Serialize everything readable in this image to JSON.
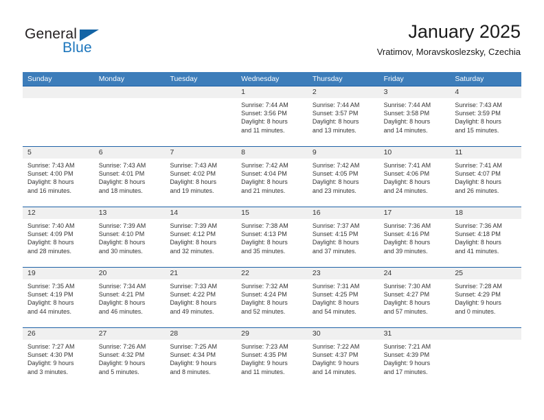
{
  "brand": {
    "word_one": "General",
    "word_two": "Blue",
    "accent_dark": "#1464a5",
    "accent_light": "#1b75bc"
  },
  "header": {
    "title": "January 2025",
    "subtitle": "Vratimov, Moravskoslezsky, Czechia"
  },
  "theme": {
    "header_bar": "#3d7dba",
    "row_separator": "#1b5fa5",
    "day_number_band": "#f0f0f0",
    "text": "#333333"
  },
  "weekdays": [
    "Sunday",
    "Monday",
    "Tuesday",
    "Wednesday",
    "Thursday",
    "Friday",
    "Saturday"
  ],
  "weeks": [
    [
      {
        "day": "",
        "lines": []
      },
      {
        "day": "",
        "lines": []
      },
      {
        "day": "",
        "lines": []
      },
      {
        "day": "1",
        "lines": [
          "Sunrise: 7:44 AM",
          "Sunset: 3:56 PM",
          "Daylight: 8 hours",
          "and 11 minutes."
        ]
      },
      {
        "day": "2",
        "lines": [
          "Sunrise: 7:44 AM",
          "Sunset: 3:57 PM",
          "Daylight: 8 hours",
          "and 13 minutes."
        ]
      },
      {
        "day": "3",
        "lines": [
          "Sunrise: 7:44 AM",
          "Sunset: 3:58 PM",
          "Daylight: 8 hours",
          "and 14 minutes."
        ]
      },
      {
        "day": "4",
        "lines": [
          "Sunrise: 7:43 AM",
          "Sunset: 3:59 PM",
          "Daylight: 8 hours",
          "and 15 minutes."
        ]
      }
    ],
    [
      {
        "day": "5",
        "lines": [
          "Sunrise: 7:43 AM",
          "Sunset: 4:00 PM",
          "Daylight: 8 hours",
          "and 16 minutes."
        ]
      },
      {
        "day": "6",
        "lines": [
          "Sunrise: 7:43 AM",
          "Sunset: 4:01 PM",
          "Daylight: 8 hours",
          "and 18 minutes."
        ]
      },
      {
        "day": "7",
        "lines": [
          "Sunrise: 7:43 AM",
          "Sunset: 4:02 PM",
          "Daylight: 8 hours",
          "and 19 minutes."
        ]
      },
      {
        "day": "8",
        "lines": [
          "Sunrise: 7:42 AM",
          "Sunset: 4:04 PM",
          "Daylight: 8 hours",
          "and 21 minutes."
        ]
      },
      {
        "day": "9",
        "lines": [
          "Sunrise: 7:42 AM",
          "Sunset: 4:05 PM",
          "Daylight: 8 hours",
          "and 23 minutes."
        ]
      },
      {
        "day": "10",
        "lines": [
          "Sunrise: 7:41 AM",
          "Sunset: 4:06 PM",
          "Daylight: 8 hours",
          "and 24 minutes."
        ]
      },
      {
        "day": "11",
        "lines": [
          "Sunrise: 7:41 AM",
          "Sunset: 4:07 PM",
          "Daylight: 8 hours",
          "and 26 minutes."
        ]
      }
    ],
    [
      {
        "day": "12",
        "lines": [
          "Sunrise: 7:40 AM",
          "Sunset: 4:09 PM",
          "Daylight: 8 hours",
          "and 28 minutes."
        ]
      },
      {
        "day": "13",
        "lines": [
          "Sunrise: 7:39 AM",
          "Sunset: 4:10 PM",
          "Daylight: 8 hours",
          "and 30 minutes."
        ]
      },
      {
        "day": "14",
        "lines": [
          "Sunrise: 7:39 AM",
          "Sunset: 4:12 PM",
          "Daylight: 8 hours",
          "and 32 minutes."
        ]
      },
      {
        "day": "15",
        "lines": [
          "Sunrise: 7:38 AM",
          "Sunset: 4:13 PM",
          "Daylight: 8 hours",
          "and 35 minutes."
        ]
      },
      {
        "day": "16",
        "lines": [
          "Sunrise: 7:37 AM",
          "Sunset: 4:15 PM",
          "Daylight: 8 hours",
          "and 37 minutes."
        ]
      },
      {
        "day": "17",
        "lines": [
          "Sunrise: 7:36 AM",
          "Sunset: 4:16 PM",
          "Daylight: 8 hours",
          "and 39 minutes."
        ]
      },
      {
        "day": "18",
        "lines": [
          "Sunrise: 7:36 AM",
          "Sunset: 4:18 PM",
          "Daylight: 8 hours",
          "and 41 minutes."
        ]
      }
    ],
    [
      {
        "day": "19",
        "lines": [
          "Sunrise: 7:35 AM",
          "Sunset: 4:19 PM",
          "Daylight: 8 hours",
          "and 44 minutes."
        ]
      },
      {
        "day": "20",
        "lines": [
          "Sunrise: 7:34 AM",
          "Sunset: 4:21 PM",
          "Daylight: 8 hours",
          "and 46 minutes."
        ]
      },
      {
        "day": "21",
        "lines": [
          "Sunrise: 7:33 AM",
          "Sunset: 4:22 PM",
          "Daylight: 8 hours",
          "and 49 minutes."
        ]
      },
      {
        "day": "22",
        "lines": [
          "Sunrise: 7:32 AM",
          "Sunset: 4:24 PM",
          "Daylight: 8 hours",
          "and 52 minutes."
        ]
      },
      {
        "day": "23",
        "lines": [
          "Sunrise: 7:31 AM",
          "Sunset: 4:25 PM",
          "Daylight: 8 hours",
          "and 54 minutes."
        ]
      },
      {
        "day": "24",
        "lines": [
          "Sunrise: 7:30 AM",
          "Sunset: 4:27 PM",
          "Daylight: 8 hours",
          "and 57 minutes."
        ]
      },
      {
        "day": "25",
        "lines": [
          "Sunrise: 7:28 AM",
          "Sunset: 4:29 PM",
          "Daylight: 9 hours",
          "and 0 minutes."
        ]
      }
    ],
    [
      {
        "day": "26",
        "lines": [
          "Sunrise: 7:27 AM",
          "Sunset: 4:30 PM",
          "Daylight: 9 hours",
          "and 3 minutes."
        ]
      },
      {
        "day": "27",
        "lines": [
          "Sunrise: 7:26 AM",
          "Sunset: 4:32 PM",
          "Daylight: 9 hours",
          "and 5 minutes."
        ]
      },
      {
        "day": "28",
        "lines": [
          "Sunrise: 7:25 AM",
          "Sunset: 4:34 PM",
          "Daylight: 9 hours",
          "and 8 minutes."
        ]
      },
      {
        "day": "29",
        "lines": [
          "Sunrise: 7:23 AM",
          "Sunset: 4:35 PM",
          "Daylight: 9 hours",
          "and 11 minutes."
        ]
      },
      {
        "day": "30",
        "lines": [
          "Sunrise: 7:22 AM",
          "Sunset: 4:37 PM",
          "Daylight: 9 hours",
          "and 14 minutes."
        ]
      },
      {
        "day": "31",
        "lines": [
          "Sunrise: 7:21 AM",
          "Sunset: 4:39 PM",
          "Daylight: 9 hours",
          "and 17 minutes."
        ]
      },
      {
        "day": "",
        "lines": []
      }
    ]
  ]
}
